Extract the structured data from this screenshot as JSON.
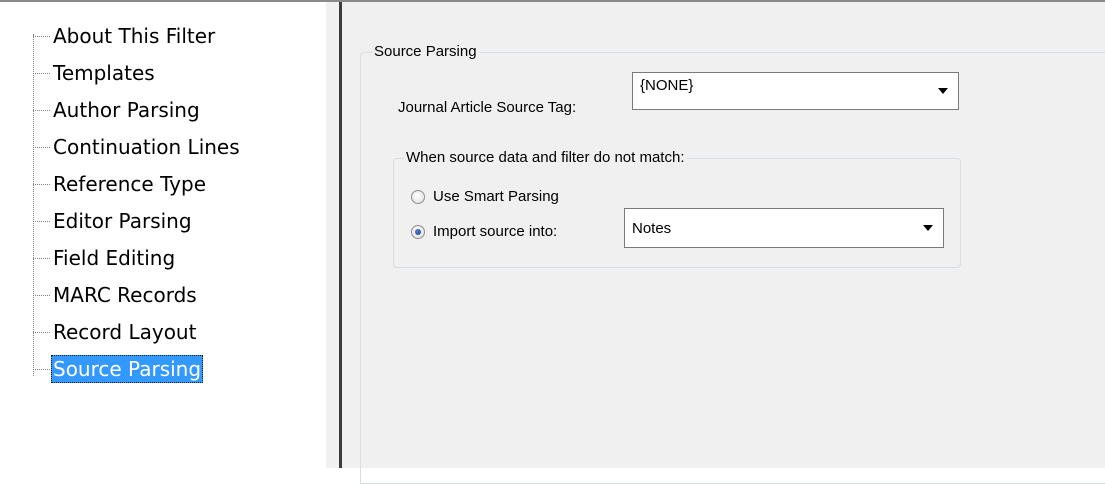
{
  "tree": {
    "items": [
      {
        "label": "About This Filter",
        "selected": false
      },
      {
        "label": "Templates",
        "selected": false
      },
      {
        "label": "Author Parsing",
        "selected": false
      },
      {
        "label": "Continuation Lines",
        "selected": false
      },
      {
        "label": "Reference Type",
        "selected": false
      },
      {
        "label": "Editor Parsing",
        "selected": false
      },
      {
        "label": "Field Editing",
        "selected": false
      },
      {
        "label": "MARC Records",
        "selected": false
      },
      {
        "label": "Record Layout",
        "selected": false
      },
      {
        "label": "Source Parsing",
        "selected": true
      }
    ]
  },
  "panel": {
    "group_title": "Source Parsing",
    "source_tag_label": "Journal Article Source Tag:",
    "source_tag_value": "{NONE}",
    "mismatch": {
      "title": "When source data and filter do not match:",
      "smart_parsing_label": "Use Smart Parsing",
      "smart_parsing_checked": false,
      "import_label": "Import source into:",
      "import_checked": true,
      "import_value": "Notes"
    }
  },
  "colors": {
    "selection": "#3399ff",
    "panel_bg": "#f0f0f0",
    "group_border": "#d5dfe5"
  }
}
